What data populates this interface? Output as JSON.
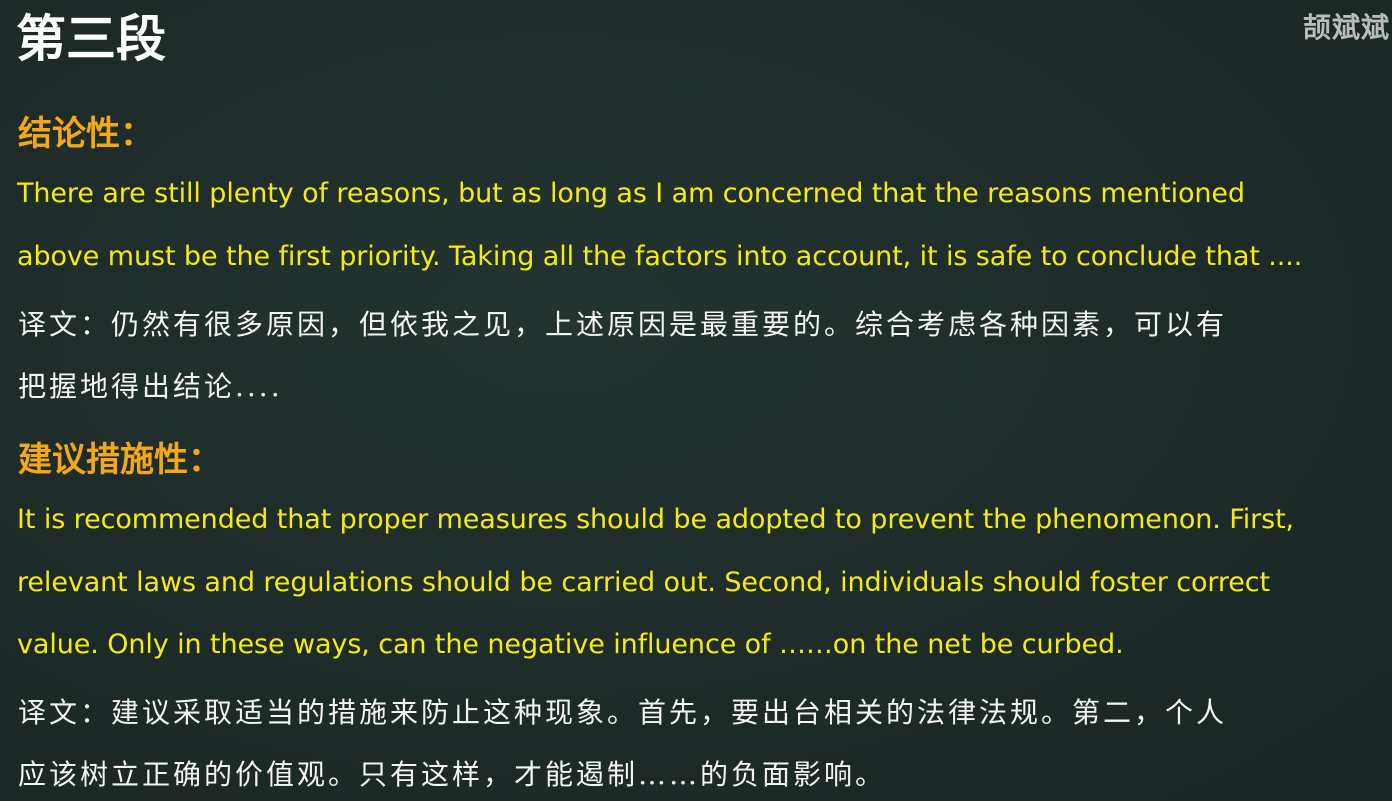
{
  "watermark": "颉斌斌",
  "title": "第三段",
  "sections": [
    {
      "heading": "结论性：",
      "english_lines": [
        "There are still plenty of reasons, but as long as I am concerned that the reasons mentioned",
        "above must be the first priority. Taking all the factors into account, it is safe to conclude that ...."
      ],
      "translation_lines": [
        "译文：仍然有很多原因，但依我之见，上述原因是最重要的。综合考虑各种因素，可以有",
        "把握地得出结论...."
      ]
    },
    {
      "heading": "建议措施性：",
      "english_lines": [
        "It is recommended that proper measures should be adopted to prevent the phenomenon. First,",
        "relevant laws and regulations should be carried out. Second, individuals should foster correct",
        "value. Only in these ways, can the negative influence of ……on the net be curbed."
      ],
      "translation_lines": [
        "译文：建议采取适当的措施来防止这种现象。首先，要出台相关的法律法规。第二，个人",
        "应该树立正确的价值观。只有这样，才能遏制……的负面影响。"
      ]
    }
  ],
  "colors": {
    "background": "#1f2b29",
    "title": "#ffffff",
    "heading": "#f3a81a",
    "english_text": "#f2ec16",
    "translation_text": "#f4f4f2",
    "watermark": "#b8bcbb"
  }
}
